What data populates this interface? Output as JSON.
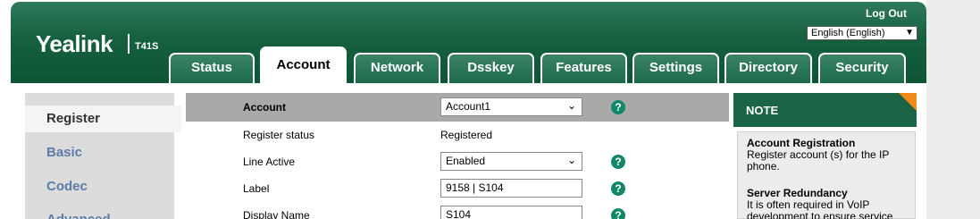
{
  "header": {
    "logo": "Yealink",
    "model": "T41S",
    "logout": "Log Out",
    "language": "English (English)"
  },
  "tabs": [
    {
      "label": "Status"
    },
    {
      "label": "Account"
    },
    {
      "label": "Network"
    },
    {
      "label": "Dsskey"
    },
    {
      "label": "Features"
    },
    {
      "label": "Settings"
    },
    {
      "label": "Directory"
    },
    {
      "label": "Security"
    }
  ],
  "sidebar": {
    "items": [
      {
        "label": "Register"
      },
      {
        "label": "Basic"
      },
      {
        "label": "Codec"
      },
      {
        "label": "Advanced"
      }
    ]
  },
  "form": {
    "account_label": "Account",
    "account_value": "Account1",
    "register_status_label": "Register status",
    "register_status_value": "Registered",
    "line_active_label": "Line Active",
    "line_active_value": "Enabled",
    "label_label": "Label",
    "label_value": "9158 | S104",
    "display_name_label": "Display Name",
    "display_name_value": "S104",
    "help_glyph": "?"
  },
  "note": {
    "title": "NOTE",
    "sections": [
      {
        "heading": "Account Registration",
        "text": "Register account (s) for the IP phone."
      },
      {
        "heading": "Server Redundancy",
        "text": "It is often required in VoIP development to ensure service"
      }
    ]
  }
}
